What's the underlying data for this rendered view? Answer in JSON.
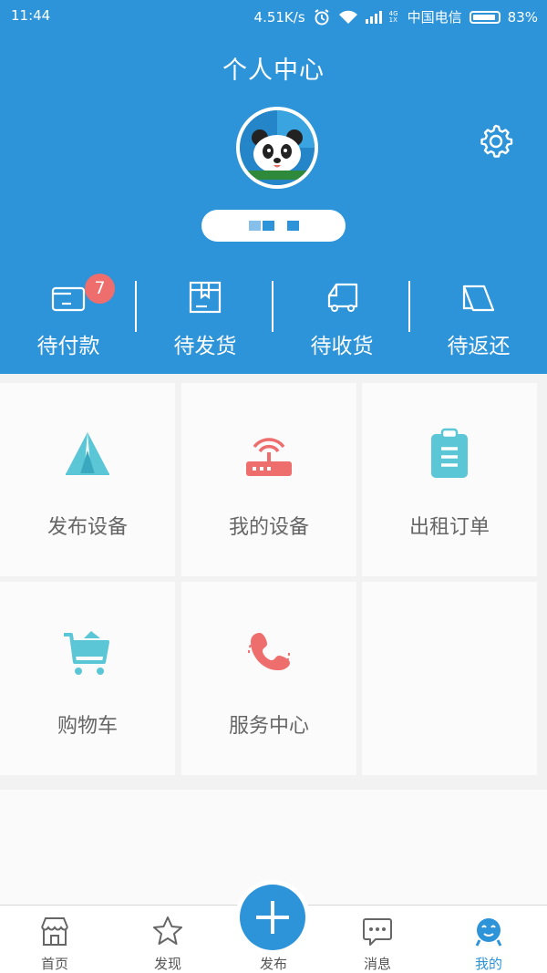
{
  "status_bar": {
    "time": "11:44",
    "net_speed": "4.51K/s",
    "network_tag": "4G 1X",
    "carrier": "中国电信",
    "battery": "83%"
  },
  "header": {
    "title": "个人中心",
    "icons": {
      "settings": "gear-icon",
      "avatar": "panda-avatar"
    }
  },
  "orders": [
    {
      "label": "待付款",
      "icon": "wallet-icon",
      "badge": "7"
    },
    {
      "label": "待发货",
      "icon": "box-icon"
    },
    {
      "label": "待收货",
      "icon": "truck-icon"
    },
    {
      "label": "待返还",
      "icon": "return-icon"
    }
  ],
  "grid": [
    {
      "label": "发布设备",
      "icon": "tent-icon",
      "color": "#5bc6d6"
    },
    {
      "label": "我的设备",
      "icon": "router-icon",
      "color": "#ee6e6e"
    },
    {
      "label": "出租订单",
      "icon": "clipboard-icon",
      "color": "#5bc6d6"
    },
    {
      "label": "购物车",
      "icon": "cart-icon",
      "color": "#5bc6d6"
    },
    {
      "label": "服务中心",
      "icon": "phone-icon",
      "color": "#ee6e6e"
    },
    {
      "label": "",
      "icon": ""
    }
  ],
  "bottom_nav": [
    {
      "label": "首页",
      "icon": "store-icon"
    },
    {
      "label": "发现",
      "icon": "star-icon"
    },
    {
      "label": "发布",
      "icon": "plus-icon"
    },
    {
      "label": "消息",
      "icon": "chat-icon"
    },
    {
      "label": "我的",
      "icon": "mascot-icon",
      "active": true
    }
  ],
  "colors": {
    "brand": "#2e94d9",
    "accent_red": "#ee6e6e",
    "accent_teal": "#5bc6d6"
  }
}
